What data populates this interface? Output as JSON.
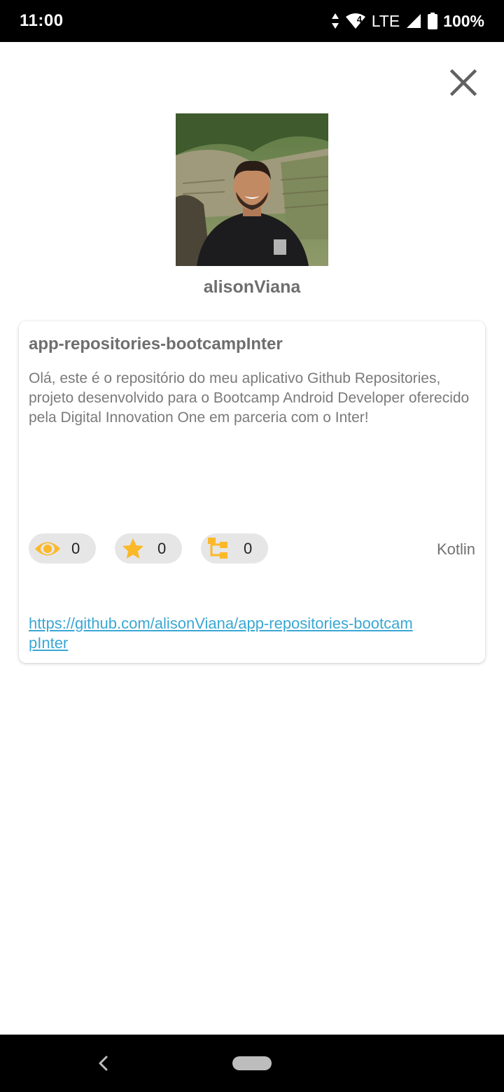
{
  "status_bar": {
    "time": "11:00",
    "network_label": "LTE",
    "battery": "100%",
    "wifi_badge": "4"
  },
  "profile": {
    "username": "alisonViana"
  },
  "repository": {
    "name": "app-repositories-bootcampInter",
    "description": "Olá, este é o repositório do meu aplicativo Github Repositories, projeto desenvolvido para o Bootcamp Android Developer oferecido pela Digital Innovation One em parceria com o Inter!",
    "watchers": "0",
    "stars": "0",
    "forks": "0",
    "language": "Kotlin",
    "url": "https://github.com/alisonViana/app-repositories-bootcampInter"
  },
  "icons": {
    "close": "close-icon",
    "watchers": "eye-icon",
    "stars": "star-icon",
    "forks": "fork-icon"
  },
  "colors": {
    "accent": "#FBB829",
    "link": "#3AA7D4",
    "chip_bg": "#E6E6E6"
  }
}
